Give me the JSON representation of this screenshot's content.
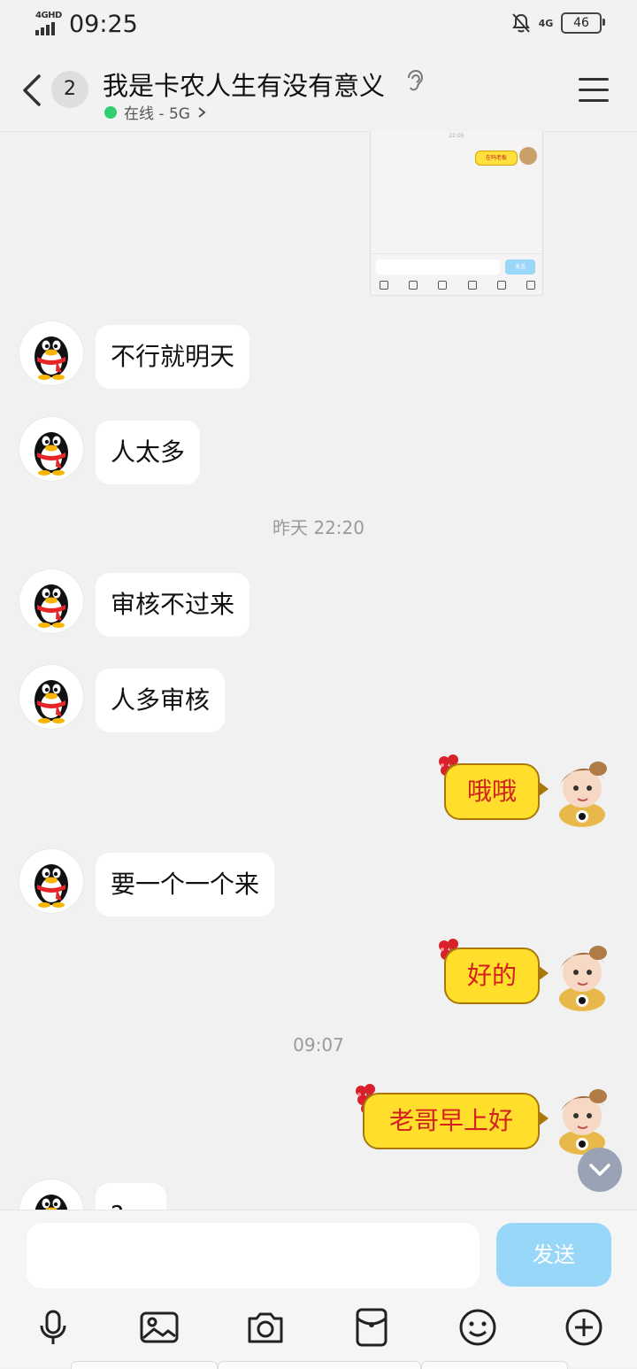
{
  "status_bar": {
    "network_label": "4GHD",
    "time": "09:25",
    "network_right": "4G",
    "battery": "46"
  },
  "header": {
    "unread_count": "2",
    "title": "我是卡农人生有没有意义",
    "presence": "在线 - 5G"
  },
  "thumbnail": {
    "time": "22:05",
    "bubble": "在吗老板",
    "send": "发送"
  },
  "messages": [
    {
      "side": "left",
      "text": "不行就明天"
    },
    {
      "side": "left",
      "text": "人太多"
    },
    {
      "type": "time",
      "text": "昨天 22:20"
    },
    {
      "side": "left",
      "text": "审核不过来"
    },
    {
      "side": "left",
      "text": "人多审核"
    },
    {
      "side": "right",
      "text": "哦哦"
    },
    {
      "side": "left",
      "text": "要一个一个来"
    },
    {
      "side": "right",
      "text": "好的"
    },
    {
      "type": "time",
      "text": "09:07"
    },
    {
      "side": "right",
      "text": "老哥早上好"
    },
    {
      "side": "left",
      "text": "?"
    }
  ],
  "composer": {
    "placeholder": "",
    "send_label": "发送"
  },
  "toolbar_icons": [
    "mic-icon",
    "image-icon",
    "camera-icon",
    "red-packet-icon",
    "emoji-icon",
    "plus-icon"
  ]
}
